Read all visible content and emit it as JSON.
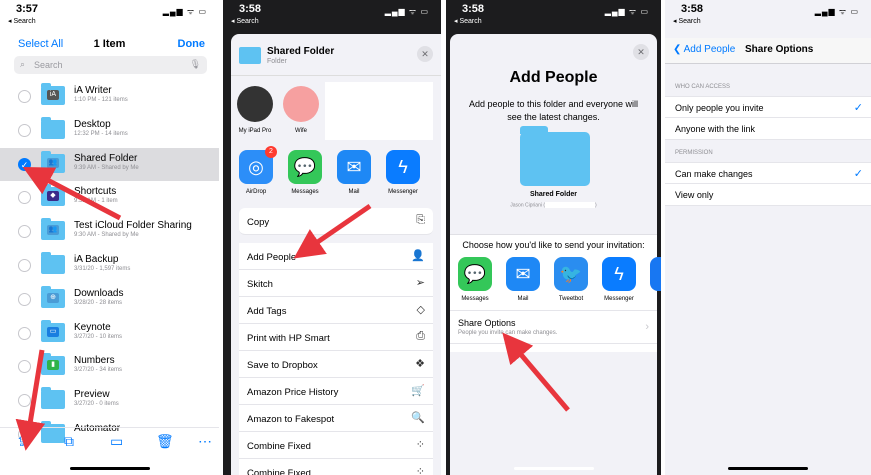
{
  "colors": {
    "accent": "#007aff",
    "arrow": "#e8353d",
    "folder": "#5ec2f2"
  },
  "panel1": {
    "status": {
      "time": "3:57",
      "back": "◂ Search",
      "icons": "▂▄▆ ᯤ ▭"
    },
    "select_all": "Select All",
    "title": "1 Item",
    "done": "Done",
    "search_placeholder": "Search",
    "files": [
      {
        "name": "iA Writer",
        "meta": "1:10 PM - 121 items",
        "glyph": "iA",
        "glyph_color": "#555"
      },
      {
        "name": "Desktop",
        "meta": "12:32 PM - 14 items",
        "glyph": "",
        "glyph_color": "#9aa"
      },
      {
        "name": "Shared Folder",
        "meta": "9:39 AM - Shared by Me",
        "glyph": "👥",
        "glyph_color": "#4a9cd6"
      },
      {
        "name": "Shortcuts",
        "meta": "9:32 AM - 1 item",
        "glyph": "◆",
        "glyph_color": "#3b2a8a"
      },
      {
        "name": "Test iCloud Folder Sharing",
        "meta": "9:30 AM - Shared by Me",
        "glyph": "👥",
        "glyph_color": "#4a9cd6"
      },
      {
        "name": "iA Backup",
        "meta": "3/31/20 - 1,597 items",
        "glyph": "",
        "glyph_color": ""
      },
      {
        "name": "Downloads",
        "meta": "3/28/20 - 28 items",
        "glyph": "⊕",
        "glyph_color": "#4a9cd6"
      },
      {
        "name": "Keynote",
        "meta": "3/27/20 - 10 items",
        "glyph": "▭",
        "glyph_color": "#1a7ee0"
      },
      {
        "name": "Numbers",
        "meta": "3/27/20 - 34 items",
        "glyph": "▮",
        "glyph_color": "#2fb34a"
      },
      {
        "name": "Preview",
        "meta": "3/27/20 - 0 items",
        "glyph": "",
        "glyph_color": ""
      },
      {
        "name": "Automator",
        "meta": "",
        "glyph": "",
        "glyph_color": ""
      }
    ],
    "toolbar": {
      "share": "⇪",
      "duplicate": "⧉",
      "move": "▭",
      "trash": "🗑",
      "more": "⋯"
    }
  },
  "panel2": {
    "status": {
      "time": "3:58",
      "back": "◂ Search",
      "icons": "▂▄▆ ᯤ ▭"
    },
    "sheet_title": "Shared Folder",
    "sheet_subtitle": "Folder",
    "close": "✕",
    "people": [
      {
        "name": "My iPad Pro",
        "color": "#333"
      },
      {
        "name": "Wife",
        "color": "#f6a0a0"
      }
    ],
    "apps": [
      {
        "name": "AirDrop",
        "icon": "◎",
        "color": "#2c8ef8",
        "badge": "2"
      },
      {
        "name": "Messages",
        "icon": "💬",
        "color": "#34c759",
        "badge": ""
      },
      {
        "name": "Mail",
        "icon": "✉",
        "color": "#1e88f5",
        "badge": ""
      },
      {
        "name": "Messenger",
        "icon": "ϟ",
        "color": "#0a7cff",
        "badge": ""
      }
    ],
    "actions": [
      {
        "label": "Copy",
        "icon": "⎘"
      },
      {
        "label": "Add People",
        "icon": "👤"
      },
      {
        "label": "Skitch",
        "icon": "➢"
      },
      {
        "label": "Add Tags",
        "icon": "◇"
      },
      {
        "label": "Print with HP Smart",
        "icon": "⎙"
      },
      {
        "label": "Save to Dropbox",
        "icon": "❖"
      },
      {
        "label": "Amazon Price History",
        "icon": "🛒"
      },
      {
        "label": "Amazon to Fakespot",
        "icon": "🔍"
      },
      {
        "label": "Combine Fixed",
        "icon": "⁘"
      },
      {
        "label": "Combine Fixed",
        "icon": "⁘"
      }
    ]
  },
  "panel3": {
    "status": {
      "time": "3:58",
      "back": "◂ Search",
      "icons": "▂▄▆ ᯤ ▭"
    },
    "close": "✕",
    "title": "Add People",
    "description": "Add people to this folder and everyone will see the latest changes.",
    "folder_name": "Shared Folder",
    "owner_prefix": "Jason Cipriani (",
    "owner_suffix": ")",
    "choose_text": "Choose how you'd like to send your invitation:",
    "apps": [
      {
        "name": "Messages",
        "icon": "💬",
        "color": "#34c759"
      },
      {
        "name": "Mail",
        "icon": "✉",
        "color": "#1e88f5"
      },
      {
        "name": "Tweetbot",
        "icon": "🐦",
        "color": "#2a8df0"
      },
      {
        "name": "Messenger",
        "icon": "ϟ",
        "color": "#0a7cff"
      },
      {
        "name": "Fa",
        "icon": "",
        "color": "#1877f2"
      }
    ],
    "share_options": {
      "title": "Share Options",
      "subtitle": "People you invite can make changes.",
      "chevron": "›"
    }
  },
  "panel4": {
    "status": {
      "time": "3:58",
      "back": "◂ Search",
      "icons": "▂▄▆ ᯤ ▭"
    },
    "back_label": "❮ Add People",
    "title": "Share Options",
    "access_header": "WHO CAN ACCESS",
    "access_options": [
      {
        "label": "Only people you invite",
        "checked": "✓"
      },
      {
        "label": "Anyone with the link",
        "checked": ""
      }
    ],
    "permission_header": "PERMISSION",
    "permission_options": [
      {
        "label": "Can make changes",
        "checked": "✓"
      },
      {
        "label": "View only",
        "checked": ""
      }
    ]
  }
}
